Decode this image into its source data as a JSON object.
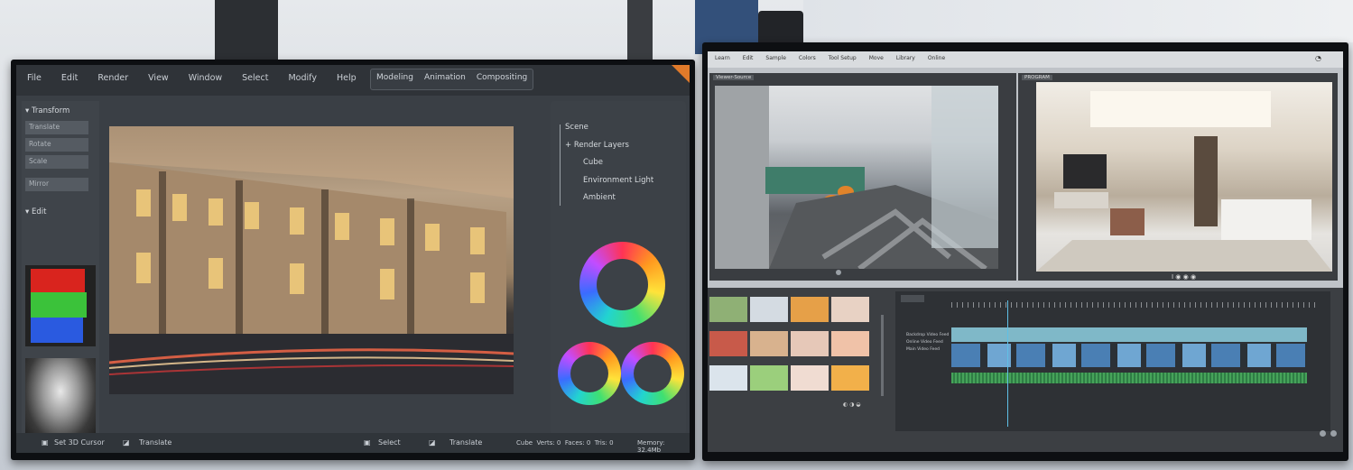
{
  "left_app": {
    "menu": [
      "File",
      "Edit",
      "Render",
      "View",
      "Window",
      "Select",
      "Modify",
      "Help"
    ],
    "modes": [
      "Modeling",
      "Animation",
      "Compositing"
    ],
    "sidebar": {
      "transform_header": "Transform",
      "transform_buttons": [
        "Translate",
        "Rotate",
        "Scale"
      ],
      "mirror_button": "Mirror",
      "edit_header": "Edit"
    },
    "outliner": {
      "root": "Scene",
      "group": "Render Layers",
      "items": [
        "Cube",
        "Environment Light",
        "Ambient"
      ]
    },
    "statusbar": {
      "cursor_tool": "Set 3D Cursor",
      "translate_left": "Translate",
      "select_tool": "Select",
      "translate_right": "Translate",
      "stats": "Cube  Verts: 0  Faces: 0  Tris: 0",
      "memory": "Memory: 32.4Mb"
    },
    "accent_color": "#e07a2a"
  },
  "right_app": {
    "menu": [
      "Learn",
      "Edit",
      "Sample",
      "Colors",
      "Tool Setup",
      "Move",
      "Library",
      "Online"
    ],
    "view1_tag": "Viewer-Source",
    "view2_tag": "PROGRAM",
    "track_labels": [
      "Backdrop Video Feed",
      "Online Video Feed",
      "Main Video Feed"
    ]
  }
}
